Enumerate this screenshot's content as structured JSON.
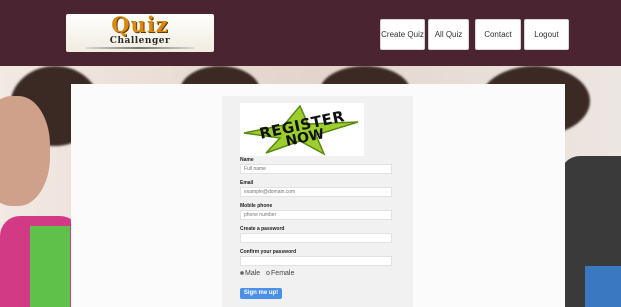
{
  "header": {
    "logo_word": "Quiz",
    "logo_sub": "Challenger",
    "nav": [
      {
        "label": "Create Quiz"
      },
      {
        "label": "All Quiz"
      },
      {
        "label": "Contact"
      },
      {
        "label": "Logout"
      }
    ],
    "bg_color": "#4a2430"
  },
  "banner": {
    "line1": "REGISTER",
    "line2": "NOW"
  },
  "form": {
    "name_label": "Name",
    "name_placeholder": "Full name",
    "email_label": "Email",
    "email_placeholder": "example@domain.com",
    "mobile_label": "Mobile phone",
    "mobile_placeholder": "phone number",
    "password_label": "Create a password",
    "confirm_label": "Confirm your password",
    "gender_male": "Male",
    "gender_female": "Female",
    "gender_selected": "Male",
    "submit_label": "Sign me up!",
    "submit_color": "#4a8fe8"
  }
}
